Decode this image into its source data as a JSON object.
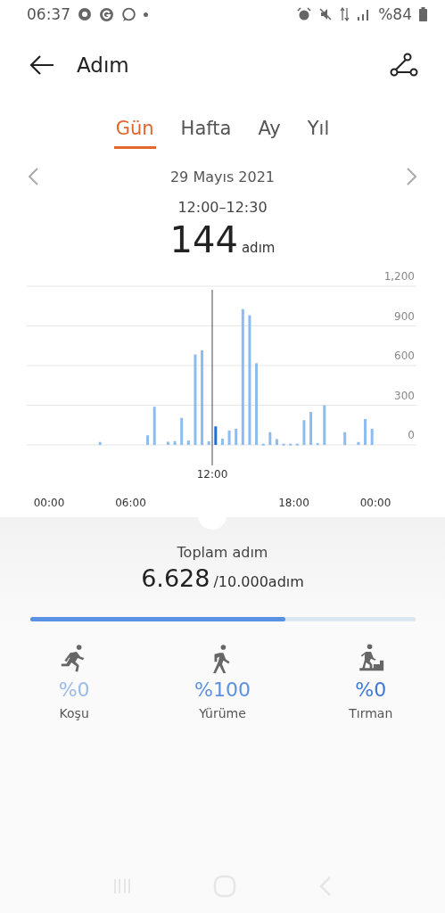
{
  "status_bar": {
    "time": "06:37",
    "battery": "%84"
  },
  "header": {
    "title": "Adım"
  },
  "tabs": [
    {
      "label": "Gün",
      "selected": true
    },
    {
      "label": "Hafta",
      "selected": false
    },
    {
      "label": "Ay",
      "selected": false
    },
    {
      "label": "Yıl",
      "selected": false
    }
  ],
  "date": "29 Mayıs 2021",
  "selection": {
    "range": "12:00–12:30",
    "value": "144",
    "unit": "adım"
  },
  "chart_data": {
    "type": "bar",
    "x": [
      3.5,
      7,
      7.5,
      8.5,
      9,
      9.5,
      10,
      10.5,
      11,
      11.5,
      12,
      12.5,
      13,
      13.5,
      14,
      14.5,
      15,
      15.5,
      16,
      16.5,
      17,
      17.5,
      18,
      18.5,
      19,
      19.5,
      20,
      21.5,
      22.5,
      23,
      23.5
    ],
    "values": [
      22,
      73,
      289,
      24,
      29,
      204,
      33,
      684,
      716,
      27,
      140,
      47,
      109,
      122,
      1027,
      980,
      618,
      9,
      96,
      44,
      9,
      9,
      9,
      187,
      249,
      13,
      300,
      96,
      22,
      196,
      122
    ],
    "xlim": [
      0,
      24
    ],
    "ylim": [
      0,
      1200
    ],
    "grid": true,
    "ref_lines": [
      {
        "axis": "x",
        "value": 12,
        "label": "12:00"
      }
    ],
    "xticks": [
      {
        "value": 0,
        "label": "00:00"
      },
      {
        "value": 6,
        "label": "06:00"
      },
      {
        "value": 18,
        "label": "18:00"
      },
      {
        "value": 24,
        "label": "00:00"
      }
    ],
    "yticks": [
      0,
      300,
      600,
      900,
      {
        "value": 1200,
        "label": "1,200"
      }
    ]
  },
  "total": {
    "label": "Toplam adım",
    "value": "6.628",
    "goal": "/10.000adım",
    "level": 0.6628
  },
  "activities": [
    {
      "kind": "run",
      "percent": "%0",
      "label": "Koşu",
      "color": "#9bbbe8"
    },
    {
      "kind": "walk",
      "percent": "%100",
      "label": "Yürüme",
      "color": "#5c90e0"
    },
    {
      "kind": "climb",
      "percent": "%0",
      "label": "Tırman",
      "color": "#3f78d8"
    }
  ]
}
